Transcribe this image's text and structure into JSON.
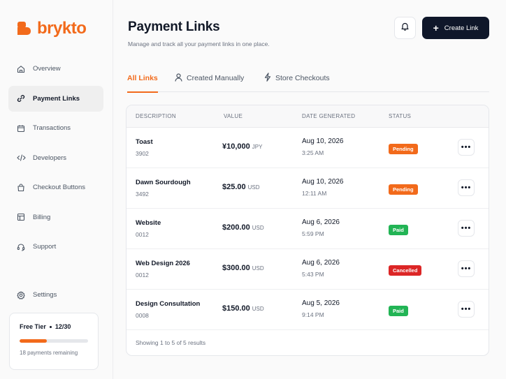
{
  "brand": {
    "name": "brykto",
    "color": "#f26a1b"
  },
  "sidebar": {
    "items": [
      {
        "label": "Overview",
        "icon": "home-icon"
      },
      {
        "label": "Payment Links",
        "icon": "link-icon",
        "active": true
      },
      {
        "label": "Transactions",
        "icon": "calendar-icon"
      },
      {
        "label": "Developers",
        "icon": "code-icon"
      },
      {
        "label": "Checkout Buttons",
        "icon": "shopping-bag-icon"
      },
      {
        "label": "Billing",
        "icon": "receipt-icon"
      },
      {
        "label": "Support",
        "icon": "headset-icon"
      }
    ],
    "settings": {
      "label": "Settings",
      "icon": "gear-icon"
    },
    "tier": {
      "title": "Free Tier",
      "usage": "12/30",
      "progress": 0.4,
      "note": "18 payments remaining"
    }
  },
  "header": {
    "title": "Payment Links",
    "subtitle": "Manage and track all your payment links in one place.",
    "create_label": "Create Link"
  },
  "tabs": [
    {
      "label": "All Links",
      "active": true
    },
    {
      "label": "Created Manually",
      "icon": "user-icon"
    },
    {
      "label": "Store Checkouts",
      "icon": "lightning-icon"
    }
  ],
  "table": {
    "columns": [
      "DESCRIPTION",
      "VALUE",
      "DATE GENERATED",
      "STATUS"
    ],
    "rows": [
      {
        "name": "Toast",
        "id": "3902",
        "amount": "¥10,000",
        "currency": "JPY",
        "date": "Aug 10, 2026",
        "time": "3:25 AM",
        "status": "Pending"
      },
      {
        "name": "Dawn Sourdough",
        "id": "3492",
        "amount": "$25.00",
        "currency": "USD",
        "date": "Aug 10, 2026",
        "time": "12:11 AM",
        "status": "Pending"
      },
      {
        "name": "Website",
        "id": "0012",
        "amount": "$200.00",
        "currency": "USD",
        "date": "Aug 6, 2026",
        "time": "5:59 PM",
        "status": "Paid"
      },
      {
        "name": "Web Design 2026",
        "id": "0012",
        "amount": "$300.00",
        "currency": "USD",
        "date": "Aug 6, 2026",
        "time": "5:43 PM",
        "status": "Cancelled"
      },
      {
        "name": "Design Consultation",
        "id": "0008",
        "amount": "$150.00",
        "currency": "USD",
        "date": "Aug 5, 2026",
        "time": "9:14 PM",
        "status": "Paid"
      }
    ],
    "more_label": "•••",
    "footer": "Showing 1 to 5 of 5 results"
  },
  "status_colors": {
    "Pending": "#f26a1b",
    "Paid": "#22b455",
    "Cancelled": "#dc2626"
  }
}
